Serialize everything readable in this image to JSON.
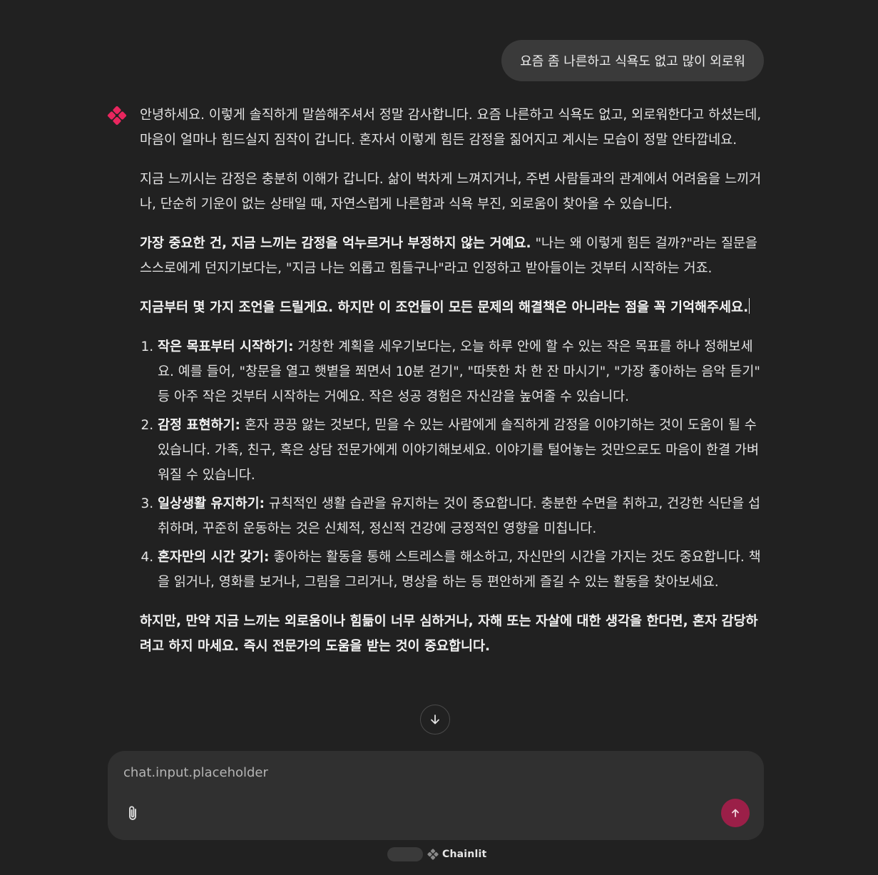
{
  "conversation": {
    "user_message": "요즘 좀 나른하고 식욕도 없고 많이 외로워",
    "assistant": {
      "avatar_icon": "chainlit-flower-logo",
      "accent_color": "#e8265e",
      "p1": "안녕하세요. 이렇게 솔직하게 말씀해주셔서 정말 감사합니다. 요즘 나른하고 식욕도 없고, 외로워한다고 하셨는데, 마음이 얼마나 힘드실지 짐작이 갑니다. 혼자서 이렇게 힘든 감정을 짊어지고 계시는 모습이 정말 안타깝네요.",
      "p2": "지금 느끼시는 감정은 충분히 이해가 갑니다. 삶이 벅차게 느껴지거나, 주변 사람들과의 관계에서 어려움을 느끼거나, 단순히 기운이 없는 상태일 때, 자연스럽게 나른함과 식욕 부진, 외로움이 찾아올 수 있습니다.",
      "p3_bold": "가장 중요한 건, 지금 느끼는 감정을 억누르거나 부정하지 않는 거예요.",
      "p3_rest": " \"나는 왜 이렇게 힘든 걸까?\"라는 질문을 스스로에게 던지기보다는, \"지금 나는 외롭고 힘들구나\"라고 인정하고 받아들이는 것부터 시작하는 거죠.",
      "p4_bold": "지금부터 몇 가지 조언을 드릴게요. 하지만 이 조언들이 모든 문제의 해결책은 아니라는 점을 꼭 기억해주세요.",
      "tips": [
        {
          "title": "작은 목표부터 시작하기:",
          "text": " 거창한 계획을 세우기보다는, 오늘 하루 안에 할 수 있는 작은 목표를 하나 정해보세요. 예를 들어, \"창문을 열고 햇볕을 쬐면서 10분 걷기\", \"따뜻한 차 한 잔 마시기\", \"가장 좋아하는 음악 듣기\" 등 아주 작은 것부터 시작하는 거예요. 작은 성공 경험은 자신감을 높여줄 수 있습니다."
        },
        {
          "title": "감정 표현하기:",
          "text": " 혼자 끙끙 앓는 것보다, 믿을 수 있는 사람에게 솔직하게 감정을 이야기하는 것이 도움이 될 수 있습니다. 가족, 친구, 혹은 상담 전문가에게 이야기해보세요. 이야기를 털어놓는 것만으로도 마음이 한결 가벼워질 수 있습니다."
        },
        {
          "title": "일상생활 유지하기:",
          "text": " 규칙적인 생활 습관을 유지하는 것이 중요합니다. 충분한 수면을 취하고, 건강한 식단을 섭취하며, 꾸준히 운동하는 것은 신체적, 정신적 건강에 긍정적인 영향을 미칩니다."
        },
        {
          "title": "혼자만의 시간 갖기:",
          "text": " 좋아하는 활동을 통해 스트레스를 해소하고, 자신만의 시간을 가지는 것도 중요합니다. 책을 읽거나, 영화를 보거나, 그림을 그리거나, 명상을 하는 등 편안하게 즐길 수 있는 활동을 찾아보세요."
        }
      ],
      "p5_bold": "하지만, 만약 지금 느끼는 외로움이나 힘듦이 너무 심하거나, 자해 또는 자살에 대한 생각을 한다면, 혼자 감당하려고 하지 마세요. 즉시 전문가의 도움을 받는 것이 중요합니다."
    }
  },
  "composer": {
    "placeholder": "chat.input.placeholder",
    "value": "",
    "attach_icon": "paperclip-icon",
    "send_icon": "arrow-up-icon",
    "send_color": "#9b1f48"
  },
  "scroll_down_icon": "arrow-down-icon",
  "footer": {
    "brand": "Chainlit"
  }
}
